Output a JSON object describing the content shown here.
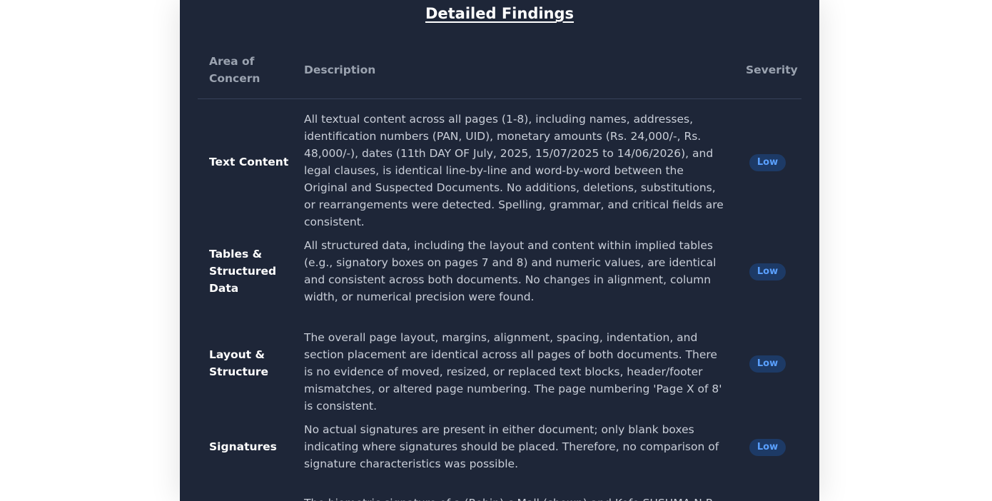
{
  "title": "Detailed Findings",
  "columns": {
    "area": "Area of Concern",
    "description": "Description",
    "severity": "Severity"
  },
  "colors": {
    "panel_bg": "#1e2638",
    "badge_bg": "#1d3a66",
    "badge_text": "#5aa0ff"
  },
  "rows": [
    {
      "area": "Text Content",
      "description": "All textual content across all pages (1-8), including names, addresses, identification numbers (PAN, UID), monetary amounts (Rs. 24,000/-, Rs. 48,000/-), dates (11th DAY OF July, 2025, 15/07/2025 to 14/06/2026), and legal clauses, is identical line-by-line and word-by-word between the Original and Suspected Documents. No additions, deletions, substitutions, or rearrangements were detected. Spelling, grammar, and critical fields are consistent.",
      "severity": "Low"
    },
    {
      "area": "Tables & Structured Data",
      "description": "All structured data, including the layout and content within implied tables (e.g., signatory boxes on pages 7 and 8) and numeric values, are identical and consistent across both documents. No changes in alignment, column width, or numerical precision were found.",
      "severity": "Low"
    },
    {
      "area": "Layout & Structure",
      "description": "The overall page layout, margins, alignment, spacing, indentation, and section placement are identical across all pages of both documents. There is no evidence of moved, resized, or replaced text blocks, header/footer mismatches, or altered page numbering. The page numbering 'Page X of 8' is consistent.",
      "severity": "Low"
    },
    {
      "area": "Signatures",
      "description": "No actual signatures are present in either document; only blank boxes indicating where signatures should be placed. Therefore, no comparison of signature characteristics was possible.",
      "severity": "Low"
    },
    {
      "area": "",
      "description": "The biometric signature of a (Robin) c Mall (shown) and Kofe SUSHMA N.R.",
      "severity": ""
    }
  ]
}
